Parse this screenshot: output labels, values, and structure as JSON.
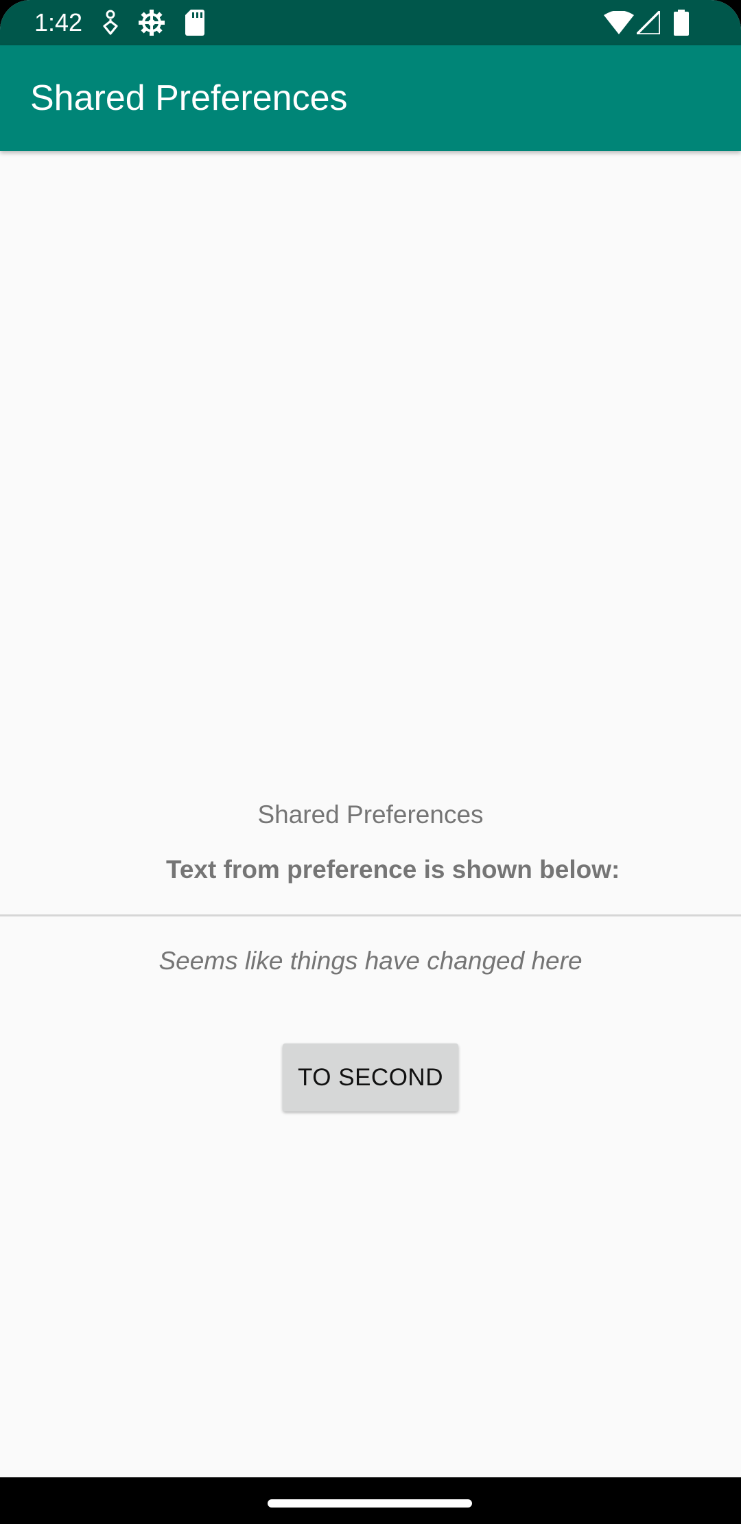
{
  "status_bar": {
    "time": "1:42",
    "icons_left": [
      "location-icon",
      "settings-gear-icon",
      "sd-card-icon"
    ],
    "icons_right": [
      "wifi-icon",
      "cell-signal-icon",
      "battery-icon"
    ],
    "background": "#00574b"
  },
  "app_bar": {
    "title": "Shared Preferences",
    "background": "#008577"
  },
  "content": {
    "heading": "Shared Preferences",
    "label": "Text from preference is shown below:",
    "preference_value": "Seems like things have changed here",
    "button_label": "TO SECOND"
  },
  "nav_bar": {
    "home_indicator": "home-pill"
  }
}
